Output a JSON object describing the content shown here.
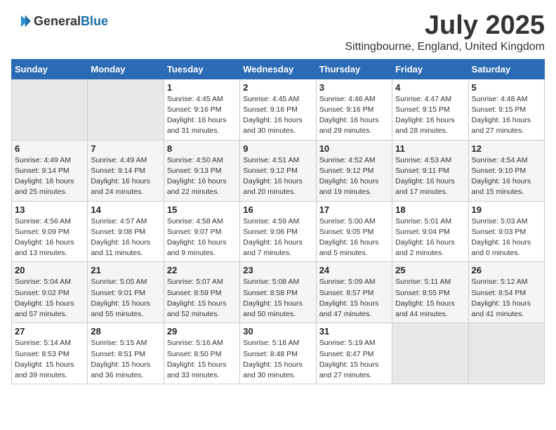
{
  "logo": {
    "general": "General",
    "blue": "Blue"
  },
  "title": "July 2025",
  "subtitle": "Sittingbourne, England, United Kingdom",
  "headers": [
    "Sunday",
    "Monday",
    "Tuesday",
    "Wednesday",
    "Thursday",
    "Friday",
    "Saturday"
  ],
  "weeks": [
    [
      {
        "day": "",
        "detail": ""
      },
      {
        "day": "",
        "detail": ""
      },
      {
        "day": "1",
        "detail": "Sunrise: 4:45 AM\nSunset: 9:16 PM\nDaylight: 16 hours\nand 31 minutes."
      },
      {
        "day": "2",
        "detail": "Sunrise: 4:45 AM\nSunset: 9:16 PM\nDaylight: 16 hours\nand 30 minutes."
      },
      {
        "day": "3",
        "detail": "Sunrise: 4:46 AM\nSunset: 9:16 PM\nDaylight: 16 hours\nand 29 minutes."
      },
      {
        "day": "4",
        "detail": "Sunrise: 4:47 AM\nSunset: 9:15 PM\nDaylight: 16 hours\nand 28 minutes."
      },
      {
        "day": "5",
        "detail": "Sunrise: 4:48 AM\nSunset: 9:15 PM\nDaylight: 16 hours\nand 27 minutes."
      }
    ],
    [
      {
        "day": "6",
        "detail": "Sunrise: 4:49 AM\nSunset: 9:14 PM\nDaylight: 16 hours\nand 25 minutes."
      },
      {
        "day": "7",
        "detail": "Sunrise: 4:49 AM\nSunset: 9:14 PM\nDaylight: 16 hours\nand 24 minutes."
      },
      {
        "day": "8",
        "detail": "Sunrise: 4:50 AM\nSunset: 9:13 PM\nDaylight: 16 hours\nand 22 minutes."
      },
      {
        "day": "9",
        "detail": "Sunrise: 4:51 AM\nSunset: 9:12 PM\nDaylight: 16 hours\nand 20 minutes."
      },
      {
        "day": "10",
        "detail": "Sunrise: 4:52 AM\nSunset: 9:12 PM\nDaylight: 16 hours\nand 19 minutes."
      },
      {
        "day": "11",
        "detail": "Sunrise: 4:53 AM\nSunset: 9:11 PM\nDaylight: 16 hours\nand 17 minutes."
      },
      {
        "day": "12",
        "detail": "Sunrise: 4:54 AM\nSunset: 9:10 PM\nDaylight: 16 hours\nand 15 minutes."
      }
    ],
    [
      {
        "day": "13",
        "detail": "Sunrise: 4:56 AM\nSunset: 9:09 PM\nDaylight: 16 hours\nand 13 minutes."
      },
      {
        "day": "14",
        "detail": "Sunrise: 4:57 AM\nSunset: 9:08 PM\nDaylight: 16 hours\nand 11 minutes."
      },
      {
        "day": "15",
        "detail": "Sunrise: 4:58 AM\nSunset: 9:07 PM\nDaylight: 16 hours\nand 9 minutes."
      },
      {
        "day": "16",
        "detail": "Sunrise: 4:59 AM\nSunset: 9:06 PM\nDaylight: 16 hours\nand 7 minutes."
      },
      {
        "day": "17",
        "detail": "Sunrise: 5:00 AM\nSunset: 9:05 PM\nDaylight: 16 hours\nand 5 minutes."
      },
      {
        "day": "18",
        "detail": "Sunrise: 5:01 AM\nSunset: 9:04 PM\nDaylight: 16 hours\nand 2 minutes."
      },
      {
        "day": "19",
        "detail": "Sunrise: 5:03 AM\nSunset: 9:03 PM\nDaylight: 16 hours\nand 0 minutes."
      }
    ],
    [
      {
        "day": "20",
        "detail": "Sunrise: 5:04 AM\nSunset: 9:02 PM\nDaylight: 15 hours\nand 57 minutes."
      },
      {
        "day": "21",
        "detail": "Sunrise: 5:05 AM\nSunset: 9:01 PM\nDaylight: 15 hours\nand 55 minutes."
      },
      {
        "day": "22",
        "detail": "Sunrise: 5:07 AM\nSunset: 8:59 PM\nDaylight: 15 hours\nand 52 minutes."
      },
      {
        "day": "23",
        "detail": "Sunrise: 5:08 AM\nSunset: 8:58 PM\nDaylight: 15 hours\nand 50 minutes."
      },
      {
        "day": "24",
        "detail": "Sunrise: 5:09 AM\nSunset: 8:57 PM\nDaylight: 15 hours\nand 47 minutes."
      },
      {
        "day": "25",
        "detail": "Sunrise: 5:11 AM\nSunset: 8:55 PM\nDaylight: 15 hours\nand 44 minutes."
      },
      {
        "day": "26",
        "detail": "Sunrise: 5:12 AM\nSunset: 8:54 PM\nDaylight: 15 hours\nand 41 minutes."
      }
    ],
    [
      {
        "day": "27",
        "detail": "Sunrise: 5:14 AM\nSunset: 8:53 PM\nDaylight: 15 hours\nand 39 minutes."
      },
      {
        "day": "28",
        "detail": "Sunrise: 5:15 AM\nSunset: 8:51 PM\nDaylight: 15 hours\nand 36 minutes."
      },
      {
        "day": "29",
        "detail": "Sunrise: 5:16 AM\nSunset: 8:50 PM\nDaylight: 15 hours\nand 33 minutes."
      },
      {
        "day": "30",
        "detail": "Sunrise: 5:18 AM\nSunset: 8:48 PM\nDaylight: 15 hours\nand 30 minutes."
      },
      {
        "day": "31",
        "detail": "Sunrise: 5:19 AM\nSunset: 8:47 PM\nDaylight: 15 hours\nand 27 minutes."
      },
      {
        "day": "",
        "detail": ""
      },
      {
        "day": "",
        "detail": ""
      }
    ]
  ]
}
